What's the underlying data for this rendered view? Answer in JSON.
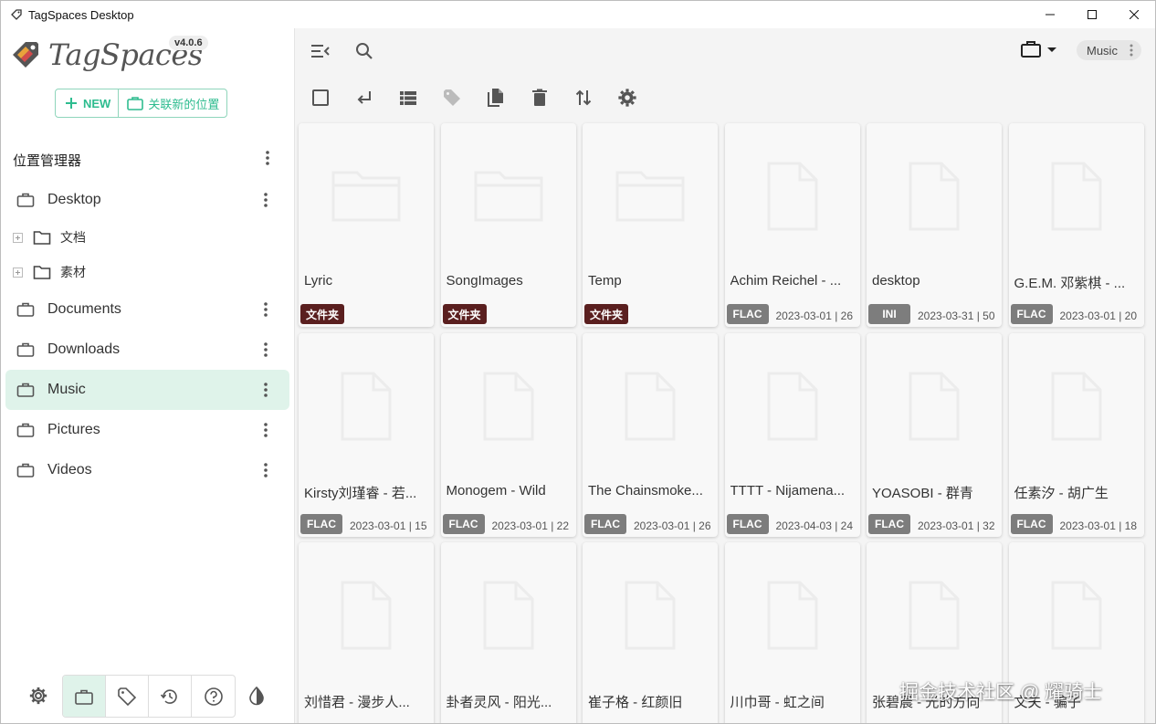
{
  "window": {
    "title": "TagSpaces Desktop"
  },
  "sidebar": {
    "logo_text": "TagSpaces",
    "version": "v4.0.6",
    "new_label": "NEW",
    "connect_label": "关联新的位置",
    "section_title": "位置管理器",
    "locations": [
      {
        "name": "Desktop",
        "children": [
          "文档",
          "素材"
        ]
      },
      {
        "name": "Documents",
        "children": []
      },
      {
        "name": "Downloads",
        "children": []
      },
      {
        "name": "Music",
        "children": [],
        "active": true
      },
      {
        "name": "Pictures",
        "children": []
      },
      {
        "name": "Videos",
        "children": []
      }
    ]
  },
  "header": {
    "current_location": "Music"
  },
  "files": [
    {
      "name": "Lyric",
      "tag": "文件夹",
      "kind": "folder",
      "meta": ""
    },
    {
      "name": "SongImages",
      "tag": "文件夹",
      "kind": "folder",
      "meta": ""
    },
    {
      "name": "Temp",
      "tag": "文件夹",
      "kind": "folder",
      "meta": ""
    },
    {
      "name": "Achim Reichel - ...",
      "tag": "FLAC",
      "kind": "file",
      "meta": "2023-03-01 | 26"
    },
    {
      "name": "desktop",
      "tag": "INI",
      "kind": "file",
      "meta": "2023-03-31 | 50"
    },
    {
      "name": "G.E.M. 邓紫棋 - ...",
      "tag": "FLAC",
      "kind": "file",
      "meta": "2023-03-01 | 20"
    },
    {
      "name": "Kirsty刘瑾睿 - 若...",
      "tag": "FLAC",
      "kind": "file",
      "meta": "2023-03-01 | 15"
    },
    {
      "name": "Monogem - Wild",
      "tag": "FLAC",
      "kind": "file",
      "meta": "2023-03-01 | 22"
    },
    {
      "name": "The Chainsmoke...",
      "tag": "FLAC",
      "kind": "file",
      "meta": "2023-03-01 | 26"
    },
    {
      "name": "TTTT - Nijamena...",
      "tag": "FLAC",
      "kind": "file",
      "meta": "2023-04-03 | 24"
    },
    {
      "name": "YOASOBI - 群青",
      "tag": "FLAC",
      "kind": "file",
      "meta": "2023-03-01 | 32"
    },
    {
      "name": "任素汐 - 胡广生",
      "tag": "FLAC",
      "kind": "file",
      "meta": "2023-03-01 | 18"
    },
    {
      "name": "刘惜君 - 漫步人...",
      "tag": "",
      "kind": "file",
      "meta": ""
    },
    {
      "name": "卦者灵风 - 阳光...",
      "tag": "",
      "kind": "file",
      "meta": ""
    },
    {
      "name": "崔子格 - 红颜旧",
      "tag": "",
      "kind": "file",
      "meta": ""
    },
    {
      "name": "川巾哥 - 虹之间",
      "tag": "",
      "kind": "file",
      "meta": ""
    },
    {
      "name": "张碧晨 - 光的方向",
      "tag": "",
      "kind": "file",
      "meta": ""
    },
    {
      "name": "文夫 - 骗子",
      "tag": "",
      "kind": "file",
      "meta": ""
    }
  ],
  "watermark": "掘金技术社区 @ 耀骑士",
  "colors": {
    "accent": "#2ebc8f",
    "folder_tag": "#5a1f1f",
    "ext_tag": "#7d7d7d",
    "active_bg": "#dff3ea"
  }
}
